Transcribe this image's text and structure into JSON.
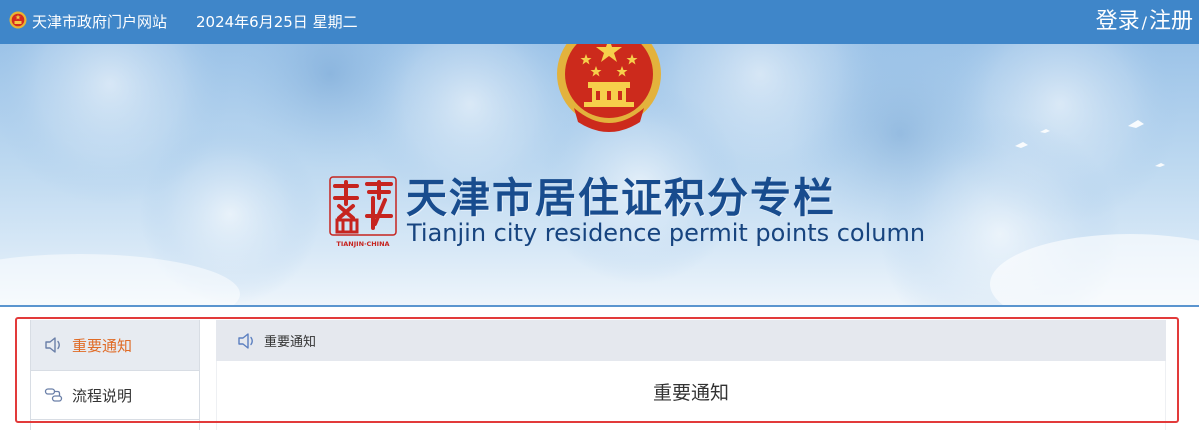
{
  "topbar": {
    "site_name": "天津市政府门户网站",
    "date": "2024年6月25日 星期二",
    "login": "登录",
    "slash": "/",
    "register": "注册"
  },
  "banner": {
    "title_cn": "天津市居住证积分专栏",
    "title_en": "Tianjin city residence permit points column",
    "seal_text": "TIANJIN·CHINA"
  },
  "sidebar": {
    "items": [
      {
        "label": "重要通知",
        "icon": "speaker-icon",
        "active": true
      },
      {
        "label": "流程说明",
        "icon": "flow-icon",
        "active": false
      }
    ]
  },
  "content": {
    "breadcrumb": "重要通知",
    "heading": "重要通知"
  },
  "colors": {
    "topbar": "#3f86c9",
    "accent": "#e06b26",
    "title": "#184c8e",
    "highlight": "#e23a3a"
  }
}
